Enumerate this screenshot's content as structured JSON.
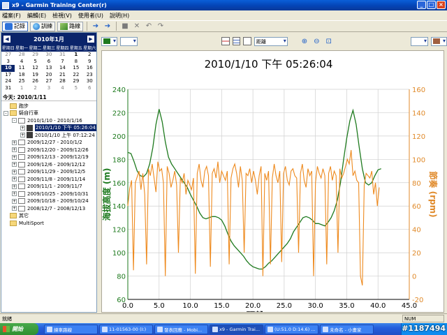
{
  "window": {
    "title": "x9 - Garmin Training Center(r)"
  },
  "menu": [
    "檔案(F)",
    "編輯(E)",
    "檢視(V)",
    "使用者(U)",
    "說明(H)"
  ],
  "toolbar": {
    "tabs": [
      "記錄",
      "訓練",
      "路線"
    ]
  },
  "calendar": {
    "month_label": "2010年1月",
    "weekdays": [
      "星期日",
      "星期一",
      "星期二",
      "星期三",
      "星期四",
      "星期五",
      "星期六"
    ],
    "days": [
      [
        "27",
        "28",
        "29",
        "30",
        "31",
        "1",
        "2"
      ],
      [
        "3",
        "4",
        "5",
        "6",
        "7",
        "8",
        "9"
      ],
      [
        "10",
        "11",
        "12",
        "13",
        "14",
        "15",
        "16"
      ],
      [
        "17",
        "18",
        "19",
        "20",
        "21",
        "22",
        "23"
      ],
      [
        "24",
        "25",
        "26",
        "27",
        "28",
        "29",
        "30"
      ],
      [
        "31",
        "1",
        "2",
        "3",
        "4",
        "5",
        "6"
      ]
    ],
    "selected_day": "10",
    "today_label": "今天: 2010/1/11"
  },
  "tree": [
    {
      "level": 0,
      "type": "folder",
      "label": "跑步",
      "expander": ""
    },
    {
      "level": 0,
      "type": "folder",
      "label": "騎自行車",
      "expander": "-"
    },
    {
      "level": 1,
      "type": "calendar",
      "label": "2010/1/10 - 2010/1/16",
      "expander": "-"
    },
    {
      "level": 2,
      "type": "run",
      "label": "2010/1/10 下午 05:26:04",
      "expander": "+",
      "selected": true
    },
    {
      "level": 2,
      "type": "run",
      "label": "2010/1/10 上午 07:12:24",
      "expander": "+"
    },
    {
      "level": 1,
      "type": "calendar",
      "label": "2009/12/27 - 2010/1/2",
      "expander": "+"
    },
    {
      "level": 1,
      "type": "calendar",
      "label": "2009/12/20 - 2009/12/26",
      "expander": "+"
    },
    {
      "level": 1,
      "type": "calendar",
      "label": "2009/12/13 - 2009/12/19",
      "expander": "+"
    },
    {
      "level": 1,
      "type": "calendar",
      "label": "2009/12/6 - 2009/12/12",
      "expander": "+"
    },
    {
      "level": 1,
      "type": "calendar",
      "label": "2009/11/29 - 2009/12/5",
      "expander": "+"
    },
    {
      "level": 1,
      "type": "calendar",
      "label": "2009/11/8 - 2009/11/14",
      "expander": "+"
    },
    {
      "level": 1,
      "type": "calendar",
      "label": "2009/11/1 - 2009/11/7",
      "expander": "+"
    },
    {
      "level": 1,
      "type": "calendar",
      "label": "2009/10/25 - 2009/10/31",
      "expander": "+"
    },
    {
      "level": 1,
      "type": "calendar",
      "label": "2009/10/18 - 2009/10/24",
      "expander": "+"
    },
    {
      "level": 1,
      "type": "calendar",
      "label": "2008/12/7 - 2008/12/13",
      "expander": "+"
    },
    {
      "level": 0,
      "type": "folder",
      "label": "其它",
      "expander": ""
    },
    {
      "level": 0,
      "type": "folder",
      "label": "MultiSport",
      "expander": ""
    }
  ],
  "chart_toolbar": {
    "x_axis_select": "距離",
    "color_left": "#1e7a1e",
    "color_right": "#a06040"
  },
  "chart_data": {
    "type": "line",
    "title": "2010/1/10 下午 05:26:04",
    "xlabel": "距離 (km)",
    "ylabel_left": "海拔高度 (m)",
    "ylabel_right": "節奏 (rpm)",
    "xlim": [
      0,
      45
    ],
    "ylim_left": [
      60,
      240
    ],
    "ylim_right": [
      -20,
      160
    ],
    "x_ticks": [
      "0.0",
      "5.0",
      "10.0",
      "15.0",
      "20.0",
      "25.0",
      "30.0",
      "35.0",
      "40.0",
      "45.0"
    ],
    "y_ticks_left": [
      "60",
      "80",
      "100",
      "120",
      "140",
      "160",
      "180",
      "200",
      "220",
      "240"
    ],
    "y_ticks_right": [
      "-20",
      "0",
      "20",
      "40",
      "60",
      "80",
      "100",
      "120",
      "140",
      "160"
    ],
    "grid": true,
    "series": [
      {
        "name": "海拔高度 (m)",
        "axis": "left",
        "color": "#1e7a1e",
        "x": [
          0,
          0.5,
          1,
          1.5,
          2,
          2.5,
          3,
          3.5,
          4,
          4.5,
          5,
          5.5,
          6,
          6.5,
          7,
          7.5,
          8,
          8.5,
          9,
          9.5,
          10,
          10.5,
          11,
          11.5,
          12,
          12.5,
          13,
          13.5,
          14,
          14.5,
          15,
          15.5,
          16,
          16.5,
          17,
          17.5,
          18,
          18.5,
          19,
          19.5,
          20,
          20.5,
          21,
          21.5,
          22,
          22.5,
          23,
          23.5,
          24,
          24.5,
          25,
          25.5,
          26,
          26.5,
          27,
          27.5,
          28,
          28.5,
          29,
          29.5,
          30,
          30.5,
          31,
          31.5,
          32,
          32.5,
          33,
          33.5,
          34,
          34.5,
          35,
          35.5,
          36,
          36.5,
          37,
          37.5,
          38,
          38.5,
          39,
          39.5,
          40,
          40.5
        ],
        "y": [
          186,
          185,
          178,
          170,
          166,
          165,
          168,
          176,
          190,
          210,
          223,
          212,
          195,
          182,
          176,
          172,
          168,
          164,
          160,
          156,
          150,
          145,
          140,
          134,
          130,
          129,
          130,
          131,
          131,
          130,
          128,
          123,
          116,
          110,
          106,
          103,
          100,
          97,
          93,
          90,
          88,
          87,
          86,
          86,
          88,
          91,
          93,
          96,
          99,
          102,
          105,
          108,
          112,
          118,
          122,
          126,
          130,
          131,
          130,
          128,
          125,
          125,
          124,
          123,
          126,
          130,
          136,
          145,
          160,
          180,
          198,
          213,
          222,
          210,
          190,
          172,
          160,
          158,
          160,
          166,
          171,
          172
        ]
      },
      {
        "name": "節奏 (rpm)",
        "axis": "right",
        "color": "#ee8a1e",
        "x": [
          0,
          0.3,
          0.6,
          0.9,
          1.2,
          1.5,
          1.8,
          2.1,
          2.4,
          2.7,
          3,
          3.3,
          3.6,
          3.9,
          4.2,
          4.5,
          4.8,
          5.1,
          5.4,
          5.7,
          6,
          6.3,
          6.6,
          6.9,
          7.2,
          7.5,
          7.8,
          8.1,
          8.4,
          8.7,
          9,
          9.3,
          9.6,
          9.9,
          10.2,
          10.5,
          10.8,
          11.1,
          11.4,
          11.7,
          12,
          12.3,
          12.6,
          12.9,
          13.2,
          13.5,
          13.8,
          14.1,
          14.4,
          14.7,
          15,
          15.3,
          15.6,
          15.9,
          16.2,
          16.5,
          16.8,
          17.1,
          17.4,
          17.7,
          18,
          18.3,
          18.6,
          18.9,
          19.2,
          19.5,
          19.8,
          20.1,
          20.4,
          20.7,
          21,
          21.3,
          21.6,
          21.9,
          22.2,
          22.5,
          22.8,
          23.1,
          23.4,
          23.7,
          24,
          24.3,
          24.6,
          24.9,
          25.2,
          25.5,
          25.8,
          26.1,
          26.4,
          26.7,
          27,
          27.3,
          27.6,
          27.9,
          28.2,
          28.5,
          28.8,
          29.1,
          29.4,
          29.7,
          30,
          30.3,
          30.6,
          30.9,
          31.2,
          31.5,
          31.8,
          32.1,
          32.4,
          32.7,
          33,
          33.3,
          33.6,
          33.9,
          34.2,
          34.5,
          34.8,
          35.1,
          35.4,
          35.7,
          36,
          36.3,
          36.6,
          36.9,
          37.2,
          37.5,
          37.8,
          38.1,
          38.4,
          38.7,
          39,
          39.3,
          39.6,
          39.9,
          40.2
        ],
        "y": [
          60,
          75,
          82,
          5,
          80,
          85,
          90,
          74,
          88,
          70,
          10,
          92,
          86,
          96,
          84,
          72,
          98,
          90,
          92,
          80,
          0,
          94,
          88,
          76,
          82,
          90,
          78,
          20,
          84,
          80,
          88,
          70,
          82,
          78,
          74,
          84,
          2,
          88,
          96,
          82,
          76,
          90,
          94,
          86,
          8,
          88,
          92,
          84,
          98,
          80,
          90,
          86,
          82,
          90,
          10,
          84,
          92,
          96,
          88,
          76,
          94,
          82,
          20,
          88,
          86,
          92,
          80,
          90,
          82,
          70,
          86,
          94,
          0,
          88,
          82,
          90,
          10,
          84,
          96,
          86,
          80,
          90,
          12,
          88,
          94,
          82,
          78,
          90,
          92,
          86,
          84,
          20,
          88,
          96,
          82,
          76,
          92,
          86,
          90,
          0,
          80,
          94,
          88,
          84,
          92,
          86,
          10,
          88,
          94,
          82,
          90,
          86,
          20,
          92,
          84,
          88,
          94,
          100,
          96,
          108,
          86,
          90,
          82,
          80,
          0,
          -8,
          78,
          88,
          86,
          84,
          90,
          70,
          80,
          60,
          76
        ]
      }
    ]
  },
  "status": {
    "left": "就緒",
    "num": "NUM"
  },
  "taskbar": {
    "start_label": "開始",
    "tasks": [
      "練車路線",
      "11-01563-00 (I:)",
      "發表回應 - Mobi...",
      "x9 - Garmin Trai...",
      "(U:51.0 D:14.6) ...",
      "未命名 - 小畫家"
    ],
    "active_task_index": 3,
    "watermark": "#1187494"
  }
}
